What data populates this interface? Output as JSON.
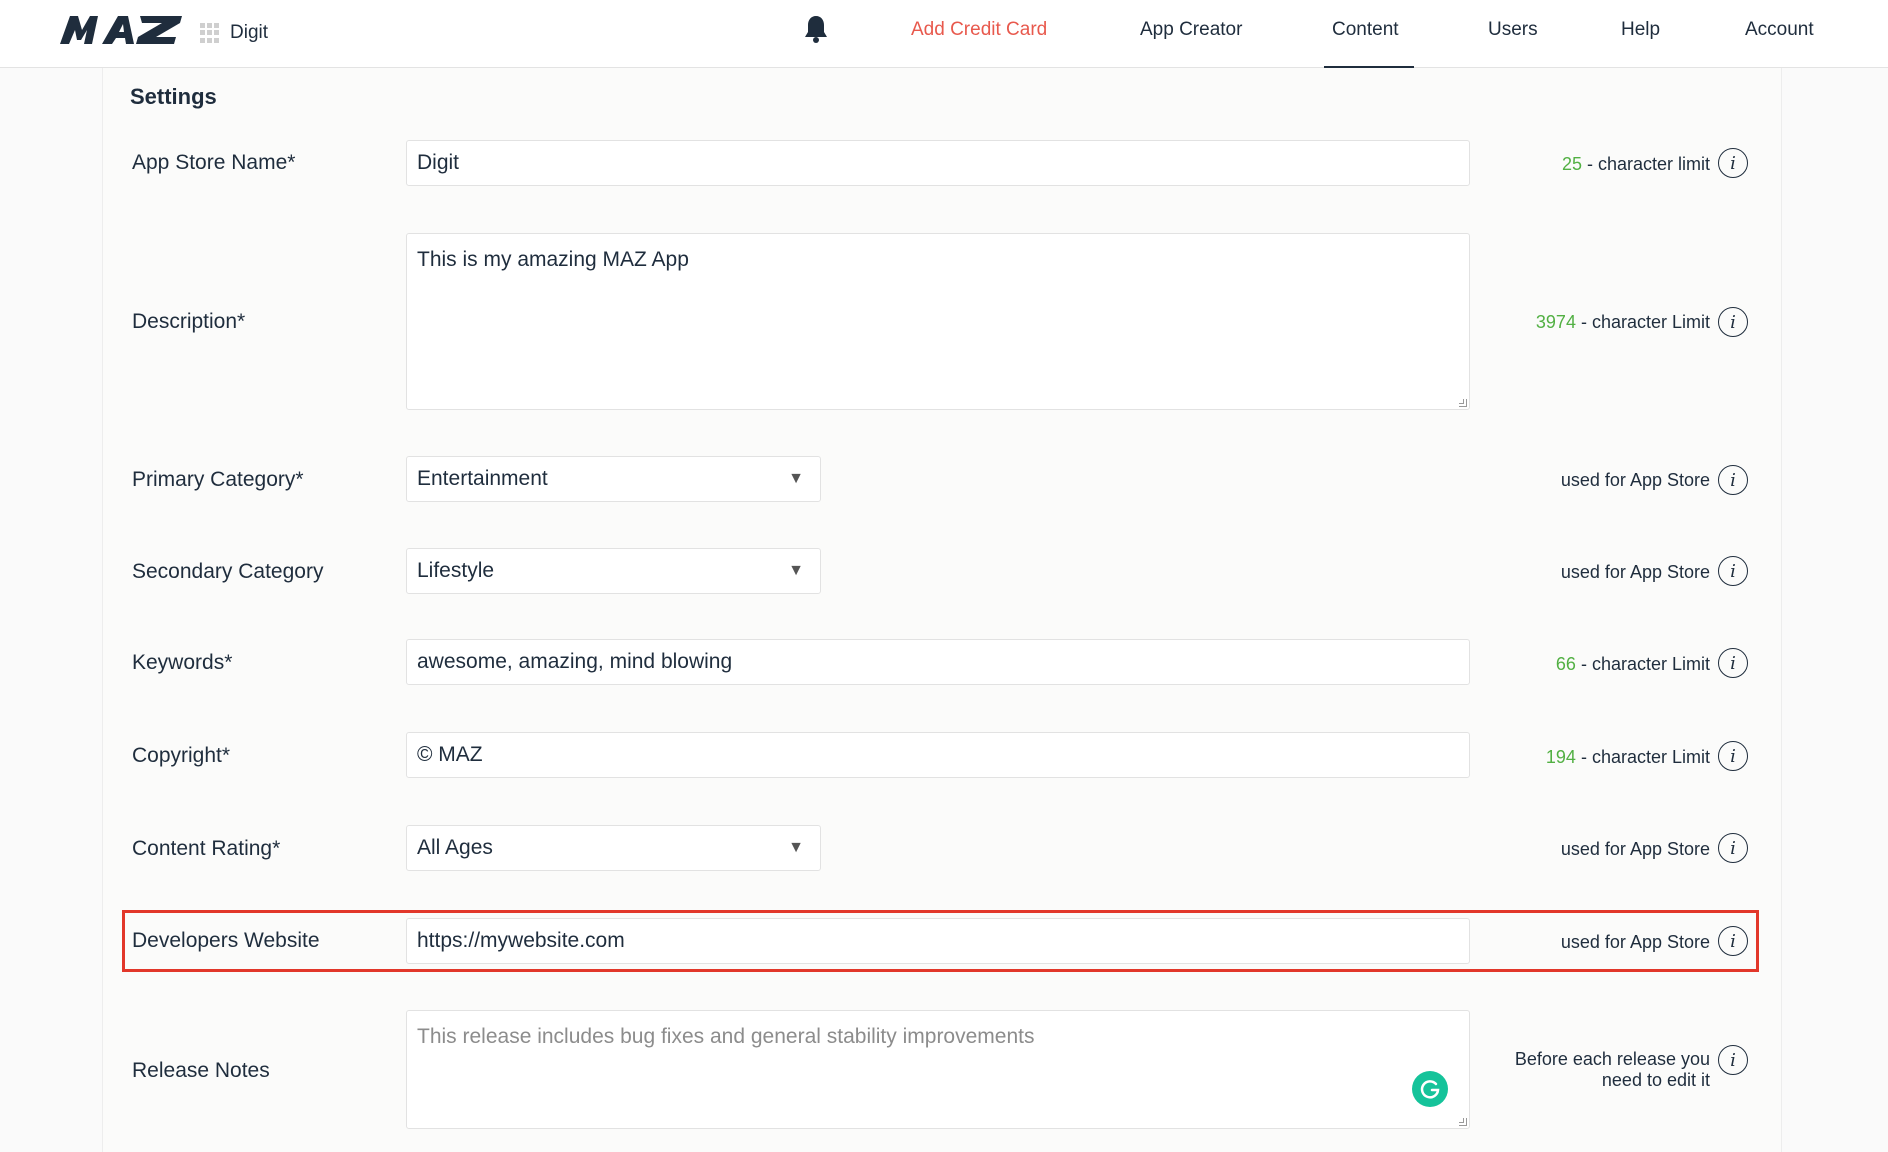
{
  "header": {
    "app_name": "Digit",
    "nav": {
      "add_credit_card": "Add Credit Card",
      "app_creator": "App Creator",
      "content": "Content",
      "users": "Users",
      "help": "Help",
      "account": "Account"
    },
    "active_tab": "Content"
  },
  "settings": {
    "title": "Settings",
    "app_store_name": {
      "label": "App Store Name*",
      "value": "Digit",
      "hint_count": "25",
      "hint_text": " - character limit"
    },
    "description": {
      "label": "Description*",
      "value": "This is my amazing MAZ App",
      "hint_count": "3974",
      "hint_text": " - character Limit"
    },
    "primary_category": {
      "label": "Primary Category*",
      "value": "Entertainment",
      "hint_text": "used for App Store"
    },
    "secondary_category": {
      "label": "Secondary Category",
      "value": "Lifestyle",
      "hint_text": "used for App Store"
    },
    "keywords": {
      "label": "Keywords*",
      "value": "awesome, amazing, mind blowing",
      "hint_count": "66",
      "hint_text": " - character Limit"
    },
    "copyright": {
      "label": "Copyright*",
      "value": "© MAZ",
      "hint_count": "194",
      "hint_text": " - character Limit"
    },
    "content_rating": {
      "label": "Content Rating*",
      "value": "All Ages",
      "hint_text": "used for App Store"
    },
    "developers_website": {
      "label": "Developers Website",
      "value": "https://mywebsite.com",
      "hint_text": "used for App Store"
    },
    "release_notes": {
      "label": "Release Notes",
      "placeholder": "This release includes bug fixes and general stability improvements",
      "hint_text": "Before each release you need to edit it"
    }
  },
  "colors": {
    "accent_alert": "#e8594d",
    "count_green": "#52b043",
    "highlight_red": "#e2372a",
    "grammarly_green": "#15c39a"
  },
  "icons": {
    "info": "info-icon",
    "bell": "bell-icon",
    "app_grid": "grid-icon",
    "dropdown": "caret-down-icon",
    "grammarly": "grammarly-icon"
  }
}
